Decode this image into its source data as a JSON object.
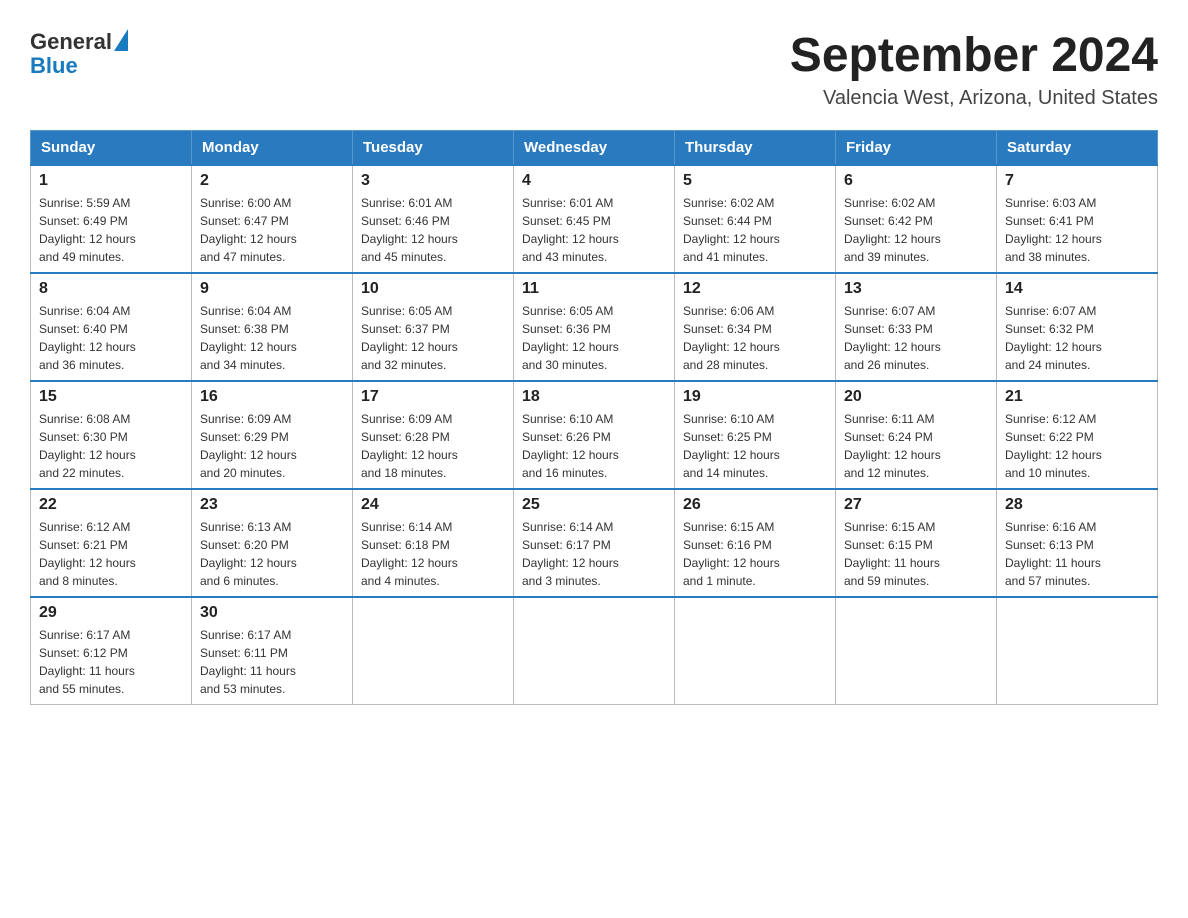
{
  "header": {
    "logo_general": "General",
    "logo_blue": "Blue",
    "month_title": "September 2024",
    "location": "Valencia West, Arizona, United States"
  },
  "days_of_week": [
    "Sunday",
    "Monday",
    "Tuesday",
    "Wednesday",
    "Thursday",
    "Friday",
    "Saturday"
  ],
  "weeks": [
    [
      {
        "day": "1",
        "sunrise": "5:59 AM",
        "sunset": "6:49 PM",
        "daylight": "12 hours and 49 minutes."
      },
      {
        "day": "2",
        "sunrise": "6:00 AM",
        "sunset": "6:47 PM",
        "daylight": "12 hours and 47 minutes."
      },
      {
        "day": "3",
        "sunrise": "6:01 AM",
        "sunset": "6:46 PM",
        "daylight": "12 hours and 45 minutes."
      },
      {
        "day": "4",
        "sunrise": "6:01 AM",
        "sunset": "6:45 PM",
        "daylight": "12 hours and 43 minutes."
      },
      {
        "day": "5",
        "sunrise": "6:02 AM",
        "sunset": "6:44 PM",
        "daylight": "12 hours and 41 minutes."
      },
      {
        "day": "6",
        "sunrise": "6:02 AM",
        "sunset": "6:42 PM",
        "daylight": "12 hours and 39 minutes."
      },
      {
        "day": "7",
        "sunrise": "6:03 AM",
        "sunset": "6:41 PM",
        "daylight": "12 hours and 38 minutes."
      }
    ],
    [
      {
        "day": "8",
        "sunrise": "6:04 AM",
        "sunset": "6:40 PM",
        "daylight": "12 hours and 36 minutes."
      },
      {
        "day": "9",
        "sunrise": "6:04 AM",
        "sunset": "6:38 PM",
        "daylight": "12 hours and 34 minutes."
      },
      {
        "day": "10",
        "sunrise": "6:05 AM",
        "sunset": "6:37 PM",
        "daylight": "12 hours and 32 minutes."
      },
      {
        "day": "11",
        "sunrise": "6:05 AM",
        "sunset": "6:36 PM",
        "daylight": "12 hours and 30 minutes."
      },
      {
        "day": "12",
        "sunrise": "6:06 AM",
        "sunset": "6:34 PM",
        "daylight": "12 hours and 28 minutes."
      },
      {
        "day": "13",
        "sunrise": "6:07 AM",
        "sunset": "6:33 PM",
        "daylight": "12 hours and 26 minutes."
      },
      {
        "day": "14",
        "sunrise": "6:07 AM",
        "sunset": "6:32 PM",
        "daylight": "12 hours and 24 minutes."
      }
    ],
    [
      {
        "day": "15",
        "sunrise": "6:08 AM",
        "sunset": "6:30 PM",
        "daylight": "12 hours and 22 minutes."
      },
      {
        "day": "16",
        "sunrise": "6:09 AM",
        "sunset": "6:29 PM",
        "daylight": "12 hours and 20 minutes."
      },
      {
        "day": "17",
        "sunrise": "6:09 AM",
        "sunset": "6:28 PM",
        "daylight": "12 hours and 18 minutes."
      },
      {
        "day": "18",
        "sunrise": "6:10 AM",
        "sunset": "6:26 PM",
        "daylight": "12 hours and 16 minutes."
      },
      {
        "day": "19",
        "sunrise": "6:10 AM",
        "sunset": "6:25 PM",
        "daylight": "12 hours and 14 minutes."
      },
      {
        "day": "20",
        "sunrise": "6:11 AM",
        "sunset": "6:24 PM",
        "daylight": "12 hours and 12 minutes."
      },
      {
        "day": "21",
        "sunrise": "6:12 AM",
        "sunset": "6:22 PM",
        "daylight": "12 hours and 10 minutes."
      }
    ],
    [
      {
        "day": "22",
        "sunrise": "6:12 AM",
        "sunset": "6:21 PM",
        "daylight": "12 hours and 8 minutes."
      },
      {
        "day": "23",
        "sunrise": "6:13 AM",
        "sunset": "6:20 PM",
        "daylight": "12 hours and 6 minutes."
      },
      {
        "day": "24",
        "sunrise": "6:14 AM",
        "sunset": "6:18 PM",
        "daylight": "12 hours and 4 minutes."
      },
      {
        "day": "25",
        "sunrise": "6:14 AM",
        "sunset": "6:17 PM",
        "daylight": "12 hours and 3 minutes."
      },
      {
        "day": "26",
        "sunrise": "6:15 AM",
        "sunset": "6:16 PM",
        "daylight": "12 hours and 1 minute."
      },
      {
        "day": "27",
        "sunrise": "6:15 AM",
        "sunset": "6:15 PM",
        "daylight": "11 hours and 59 minutes."
      },
      {
        "day": "28",
        "sunrise": "6:16 AM",
        "sunset": "6:13 PM",
        "daylight": "11 hours and 57 minutes."
      }
    ],
    [
      {
        "day": "29",
        "sunrise": "6:17 AM",
        "sunset": "6:12 PM",
        "daylight": "11 hours and 55 minutes."
      },
      {
        "day": "30",
        "sunrise": "6:17 AM",
        "sunset": "6:11 PM",
        "daylight": "11 hours and 53 minutes."
      },
      null,
      null,
      null,
      null,
      null
    ]
  ],
  "labels": {
    "sunrise_prefix": "Sunrise: ",
    "sunset_prefix": "Sunset: ",
    "daylight_prefix": "Daylight: "
  }
}
